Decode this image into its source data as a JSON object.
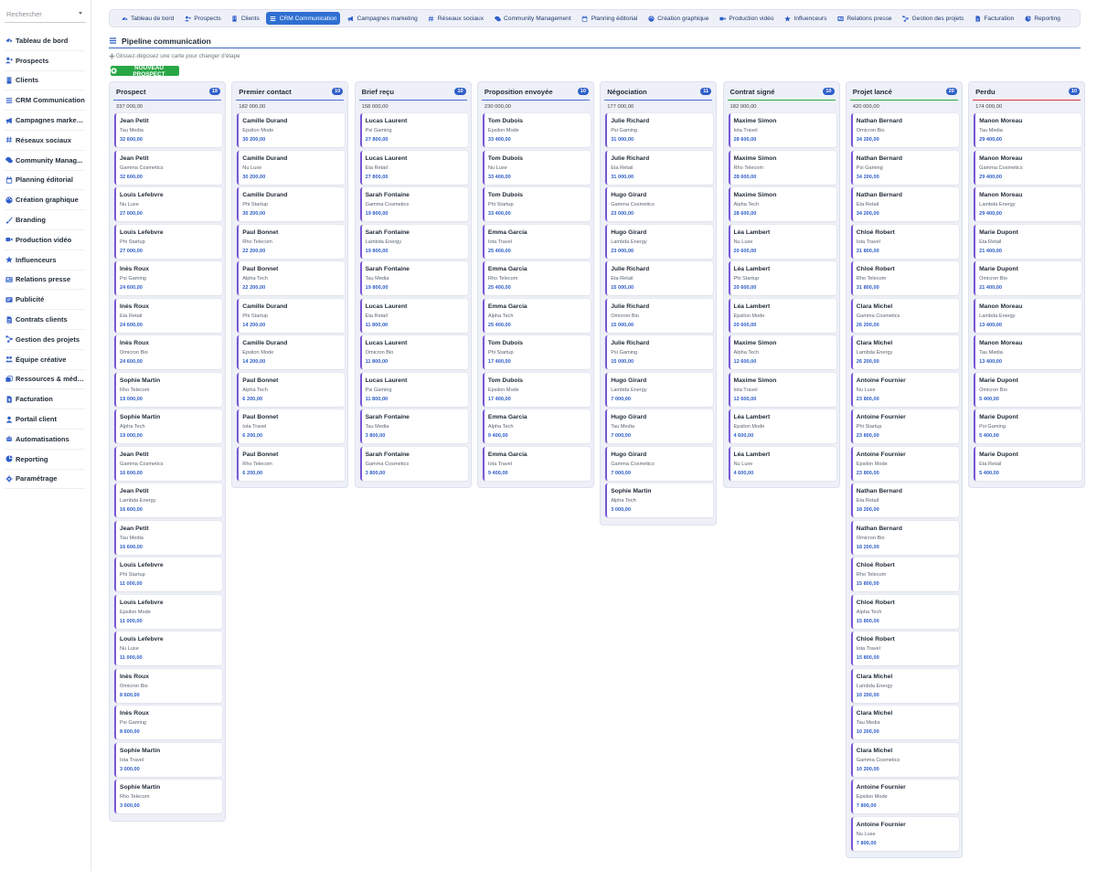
{
  "search": {
    "placeholder": "Rechercher"
  },
  "sidebar": {
    "items": [
      {
        "label": "Tableau de bord",
        "icon": "gauge-icon",
        "name": "tableau-de-bord"
      },
      {
        "label": "Prospects",
        "icon": "user-plus-icon",
        "name": "prospects"
      },
      {
        "label": "Clients",
        "icon": "building-icon",
        "name": "clients"
      },
      {
        "label": "CRM Communication",
        "icon": "bars-icon",
        "name": "crm-communication"
      },
      {
        "label": "Campagnes marketing",
        "icon": "megaphone-icon",
        "name": "campagnes-marketing"
      },
      {
        "label": "Réseaux sociaux",
        "icon": "hashtag-icon",
        "name": "reseaux-sociaux"
      },
      {
        "label": "Community Manag...",
        "icon": "comments-icon",
        "name": "community-management"
      },
      {
        "label": "Planning éditorial",
        "icon": "calendar-icon",
        "name": "planning-editorial"
      },
      {
        "label": "Création graphique",
        "icon": "palette-icon",
        "name": "creation-graphique"
      },
      {
        "label": "Branding",
        "icon": "brush-icon",
        "name": "branding"
      },
      {
        "label": "Production vidéo",
        "icon": "video-icon",
        "name": "production-video"
      },
      {
        "label": "Influenceurs",
        "icon": "star-icon",
        "name": "influenceurs"
      },
      {
        "label": "Relations presse",
        "icon": "newspaper-icon",
        "name": "relations-presse"
      },
      {
        "label": "Publicité",
        "icon": "ad-icon",
        "name": "publicite"
      },
      {
        "label": "Contrats clients",
        "icon": "contract-icon",
        "name": "contrats-clients"
      },
      {
        "label": "Gestion des projets",
        "icon": "project-diagram-icon",
        "name": "gestion-des-projets"
      },
      {
        "label": "Équipe créative",
        "icon": "users-icon",
        "name": "equipe-creative"
      },
      {
        "label": "Ressources & médias",
        "icon": "photo-video-icon",
        "name": "ressources-medias"
      },
      {
        "label": "Facturation",
        "icon": "invoice-icon",
        "name": "facturation"
      },
      {
        "label": "Portail client",
        "icon": "portal-icon",
        "name": "portail-client"
      },
      {
        "label": "Automatisations",
        "icon": "robot-icon",
        "name": "automatisations"
      },
      {
        "label": "Reporting",
        "icon": "chart-pie-icon",
        "name": "reporting"
      },
      {
        "label": "Paramétrage",
        "icon": "gear-icon",
        "name": "parametrage"
      }
    ]
  },
  "tabs": [
    {
      "label": "Tableau de bord",
      "icon": "gauge-icon",
      "name": "tableau-de-bord"
    },
    {
      "label": "Prospects",
      "icon": "user-plus-icon",
      "name": "prospects"
    },
    {
      "label": "Clients",
      "icon": "building-icon",
      "name": "clients"
    },
    {
      "label": "CRM Communication",
      "icon": "bars-icon",
      "name": "crm-communication",
      "active": true
    },
    {
      "label": "Campagnes marketing",
      "icon": "megaphone-icon",
      "name": "campagnes-marketing"
    },
    {
      "label": "Réseaux sociaux",
      "icon": "hashtag-icon",
      "name": "reseaux-sociaux"
    },
    {
      "label": "Community Management",
      "icon": "comments-icon",
      "name": "community-management"
    },
    {
      "label": "Planning éditorial",
      "icon": "calendar-icon",
      "name": "planning-editorial"
    },
    {
      "label": "Création graphique",
      "icon": "palette-icon",
      "name": "creation-graphique"
    },
    {
      "label": "Production vidéo",
      "icon": "video-icon",
      "name": "production-video"
    },
    {
      "label": "Influenceurs",
      "icon": "star-icon",
      "name": "influenceurs"
    },
    {
      "label": "Relations presse",
      "icon": "newspaper-icon",
      "name": "relations-presse"
    },
    {
      "label": "Gestion des projets",
      "icon": "project-diagram-icon",
      "name": "gestion-des-projets"
    },
    {
      "label": "Facturation",
      "icon": "invoice-icon",
      "name": "facturation"
    },
    {
      "label": "Reporting",
      "icon": "chart-pie-icon",
      "name": "reporting"
    }
  ],
  "page": {
    "title": "Pipeline communication",
    "hint": "Glissez-déposez une carte pour changer d'étape",
    "new_button": "NOUVEAU PROSPECT"
  },
  "colors": {
    "accent": "#2f6fd1",
    "card_border": "#7957d5",
    "amount": "#2f5fc9",
    "success": "#28a745",
    "danger": "#dc3545"
  },
  "columns": [
    {
      "title": "Prospect",
      "count": "19",
      "total": "337 000,00",
      "accent": "#4a6fcf",
      "cards": [
        {
          "name": "Jean Petit",
          "company": "Tau Media",
          "amount": "32 600,00"
        },
        {
          "name": "Jean Petit",
          "company": "Gamma Cosmetics",
          "amount": "32 600,00"
        },
        {
          "name": "Louis Lefebvre",
          "company": "Nu Luxe",
          "amount": "27 000,00"
        },
        {
          "name": "Louis Lefebvre",
          "company": "Phi Startup",
          "amount": "27 000,00"
        },
        {
          "name": "Inès Roux",
          "company": "Psi Gaming",
          "amount": "24 600,00"
        },
        {
          "name": "Inès Roux",
          "company": "Eta Retail",
          "amount": "24 600,00"
        },
        {
          "name": "Inès Roux",
          "company": "Omicron Bio",
          "amount": "24 600,00"
        },
        {
          "name": "Sophie Martin",
          "company": "Rho Telecom",
          "amount": "19 000,00"
        },
        {
          "name": "Sophie Martin",
          "company": "Alpha Tech",
          "amount": "19 000,00"
        },
        {
          "name": "Jean Petit",
          "company": "Gamma Cosmetics",
          "amount": "16 600,00"
        },
        {
          "name": "Jean Petit",
          "company": "Lambda Energy",
          "amount": "16 600,00"
        },
        {
          "name": "Jean Petit",
          "company": "Tau Media",
          "amount": "16 600,00"
        },
        {
          "name": "Louis Lefebvre",
          "company": "Phi Startup",
          "amount": "11 000,00"
        },
        {
          "name": "Louis Lefebvre",
          "company": "Epsilon Mode",
          "amount": "11 000,00"
        },
        {
          "name": "Louis Lefebvre",
          "company": "Nu Luxe",
          "amount": "11 000,00"
        },
        {
          "name": "Inès Roux",
          "company": "Omicron Bio",
          "amount": "8 600,00"
        },
        {
          "name": "Inès Roux",
          "company": "Psi Gaming",
          "amount": "8 600,00"
        },
        {
          "name": "Sophie Martin",
          "company": "Iota Travel",
          "amount": "3 000,00"
        },
        {
          "name": "Sophie Martin",
          "company": "Rho Telecom",
          "amount": "3 000,00"
        }
      ]
    },
    {
      "title": "Premier contact",
      "count": "10",
      "total": "182 000,00",
      "accent": "#4a6fcf",
      "cards": [
        {
          "name": "Camille Durand",
          "company": "Epsilon Mode",
          "amount": "30 200,00"
        },
        {
          "name": "Camille Durand",
          "company": "Nu Luxe",
          "amount": "30 200,00"
        },
        {
          "name": "Camille Durand",
          "company": "Phi Startup",
          "amount": "30 200,00"
        },
        {
          "name": "Paul Bonnet",
          "company": "Rho Telecom",
          "amount": "22 200,00"
        },
        {
          "name": "Paul Bonnet",
          "company": "Alpha Tech",
          "amount": "22 200,00"
        },
        {
          "name": "Camille Durand",
          "company": "Phi Startup",
          "amount": "14 200,00"
        },
        {
          "name": "Camille Durand",
          "company": "Epsilon Mode",
          "amount": "14 200,00"
        },
        {
          "name": "Paul Bonnet",
          "company": "Alpha Tech",
          "amount": "6 200,00"
        },
        {
          "name": "Paul Bonnet",
          "company": "Iota Travel",
          "amount": "6 200,00"
        },
        {
          "name": "Paul Bonnet",
          "company": "Rho Telecom",
          "amount": "6 200,00"
        }
      ]
    },
    {
      "title": "Brief reçu",
      "count": "10",
      "total": "158 000,00",
      "accent": "#4a6fcf",
      "cards": [
        {
          "name": "Lucas Laurent",
          "company": "Psi Gaming",
          "amount": "27 800,00"
        },
        {
          "name": "Lucas Laurent",
          "company": "Eta Retail",
          "amount": "27 800,00"
        },
        {
          "name": "Sarah Fontaine",
          "company": "Gamma Cosmetics",
          "amount": "19 800,00"
        },
        {
          "name": "Sarah Fontaine",
          "company": "Lambda Energy",
          "amount": "19 800,00"
        },
        {
          "name": "Sarah Fontaine",
          "company": "Tau Media",
          "amount": "19 800,00"
        },
        {
          "name": "Lucas Laurent",
          "company": "Eta Retail",
          "amount": "11 800,00"
        },
        {
          "name": "Lucas Laurent",
          "company": "Omicron Bio",
          "amount": "11 800,00"
        },
        {
          "name": "Lucas Laurent",
          "company": "Psi Gaming",
          "amount": "11 800,00"
        },
        {
          "name": "Sarah Fontaine",
          "company": "Tau Media",
          "amount": "3 800,00"
        },
        {
          "name": "Sarah Fontaine",
          "company": "Gamma Cosmetics",
          "amount": "3 800,00"
        }
      ]
    },
    {
      "title": "Proposition envoyée",
      "count": "10",
      "total": "230 000,00",
      "accent": "#4a6fcf",
      "cards": [
        {
          "name": "Tom Dubois",
          "company": "Epsilon Mode",
          "amount": "33 400,00"
        },
        {
          "name": "Tom Dubois",
          "company": "Nu Luxe",
          "amount": "33 400,00"
        },
        {
          "name": "Tom Dubois",
          "company": "Phi Startup",
          "amount": "33 400,00"
        },
        {
          "name": "Emma Garcia",
          "company": "Iota Travel",
          "amount": "25 400,00"
        },
        {
          "name": "Emma Garcia",
          "company": "Rho Telecom",
          "amount": "25 400,00"
        },
        {
          "name": "Emma Garcia",
          "company": "Alpha Tech",
          "amount": "25 400,00"
        },
        {
          "name": "Tom Dubois",
          "company": "Phi Startup",
          "amount": "17 400,00"
        },
        {
          "name": "Tom Dubois",
          "company": "Epsilon Mode",
          "amount": "17 400,00"
        },
        {
          "name": "Emma Garcia",
          "company": "Alpha Tech",
          "amount": "9 400,00"
        },
        {
          "name": "Emma Garcia",
          "company": "Iota Travel",
          "amount": "9 400,00"
        }
      ]
    },
    {
      "title": "Négociation",
      "count": "11",
      "total": "177 000,00",
      "accent": "#4a6fcf",
      "cards": [
        {
          "name": "Julie Richard",
          "company": "Psi Gaming",
          "amount": "31 000,00"
        },
        {
          "name": "Julie Richard",
          "company": "Eta Retail",
          "amount": "31 000,00"
        },
        {
          "name": "Hugo Girard",
          "company": "Gamma Cosmetics",
          "amount": "23 000,00"
        },
        {
          "name": "Hugo Girard",
          "company": "Lambda Energy",
          "amount": "23 000,00"
        },
        {
          "name": "Julie Richard",
          "company": "Eta Retail",
          "amount": "15 000,00"
        },
        {
          "name": "Julie Richard",
          "company": "Omicron Bio",
          "amount": "15 000,00"
        },
        {
          "name": "Julie Richard",
          "company": "Psi Gaming",
          "amount": "15 000,00"
        },
        {
          "name": "Hugo Girard",
          "company": "Lambda Energy",
          "amount": "7 000,00"
        },
        {
          "name": "Hugo Girard",
          "company": "Tau Media",
          "amount": "7 000,00"
        },
        {
          "name": "Hugo Girard",
          "company": "Gamma Cosmetics",
          "amount": "7 000,00"
        },
        {
          "name": "Sophie Martin",
          "company": "Alpha Tech",
          "amount": "3 000,00"
        }
      ]
    },
    {
      "title": "Contrat signé",
      "count": "10",
      "total": "182 000,00",
      "accent": "#28a745",
      "cards": [
        {
          "name": "Maxime Simon",
          "company": "Iota Travel",
          "amount": "28 600,00"
        },
        {
          "name": "Maxime Simon",
          "company": "Rho Telecom",
          "amount": "28 600,00"
        },
        {
          "name": "Maxime Simon",
          "company": "Alpha Tech",
          "amount": "28 600,00"
        },
        {
          "name": "Léa Lambert",
          "company": "Nu Luxe",
          "amount": "20 600,00"
        },
        {
          "name": "Léa Lambert",
          "company": "Phi Startup",
          "amount": "20 600,00"
        },
        {
          "name": "Léa Lambert",
          "company": "Epsilon Mode",
          "amount": "20 600,00"
        },
        {
          "name": "Maxime Simon",
          "company": "Alpha Tech",
          "amount": "12 600,00"
        },
        {
          "name": "Maxime Simon",
          "company": "Iota Travel",
          "amount": "12 600,00"
        },
        {
          "name": "Léa Lambert",
          "company": "Epsilon Mode",
          "amount": "4 600,00"
        },
        {
          "name": "Léa Lambert",
          "company": "Nu Luxe",
          "amount": "4 600,00"
        }
      ]
    },
    {
      "title": "Projet lancé",
      "count": "20",
      "total": "420 000,00",
      "accent": "#28a745",
      "cards": [
        {
          "name": "Nathan Bernard",
          "company": "Omicron Bio",
          "amount": "34 200,00"
        },
        {
          "name": "Nathan Bernard",
          "company": "Psi Gaming",
          "amount": "34 200,00"
        },
        {
          "name": "Nathan Bernard",
          "company": "Eta Retail",
          "amount": "34 200,00"
        },
        {
          "name": "Chloé Robert",
          "company": "Iota Travel",
          "amount": "31 800,00"
        },
        {
          "name": "Chloé Robert",
          "company": "Rho Telecom",
          "amount": "31 800,00"
        },
        {
          "name": "Clara Michel",
          "company": "Gamma Cosmetics",
          "amount": "26 200,00"
        },
        {
          "name": "Clara Michel",
          "company": "Lambda Energy",
          "amount": "26 200,00"
        },
        {
          "name": "Antoine Fournier",
          "company": "Nu Luxe",
          "amount": "23 800,00"
        },
        {
          "name": "Antoine Fournier",
          "company": "Phi Startup",
          "amount": "23 800,00"
        },
        {
          "name": "Antoine Fournier",
          "company": "Epsilon Mode",
          "amount": "23 800,00"
        },
        {
          "name": "Nathan Bernard",
          "company": "Eta Retail",
          "amount": "18 200,00"
        },
        {
          "name": "Nathan Bernard",
          "company": "Omicron Bio",
          "amount": "18 200,00"
        },
        {
          "name": "Chloé Robert",
          "company": "Rho Telecom",
          "amount": "15 800,00"
        },
        {
          "name": "Chloé Robert",
          "company": "Alpha Tech",
          "amount": "15 800,00"
        },
        {
          "name": "Chloé Robert",
          "company": "Iota Travel",
          "amount": "15 800,00"
        },
        {
          "name": "Clara Michel",
          "company": "Lambda Energy",
          "amount": "10 200,00"
        },
        {
          "name": "Clara Michel",
          "company": "Tau Media",
          "amount": "10 200,00"
        },
        {
          "name": "Clara Michel",
          "company": "Gamma Cosmetics",
          "amount": "10 200,00"
        },
        {
          "name": "Antoine Fournier",
          "company": "Epsilon Mode",
          "amount": "7 800,00"
        },
        {
          "name": "Antoine Fournier",
          "company": "Nu Luxe",
          "amount": "7 800,00"
        }
      ]
    },
    {
      "title": "Perdu",
      "count": "10",
      "total": "174 000,00",
      "accent": "#dc3545",
      "cards": [
        {
          "name": "Manon Moreau",
          "company": "Tau Media",
          "amount": "29 400,00"
        },
        {
          "name": "Manon Moreau",
          "company": "Gamma Cosmetics",
          "amount": "29 400,00"
        },
        {
          "name": "Manon Moreau",
          "company": "Lambda Energy",
          "amount": "29 400,00"
        },
        {
          "name": "Marie Dupont",
          "company": "Eta Retail",
          "amount": "21 400,00"
        },
        {
          "name": "Marie Dupont",
          "company": "Omicron Bio",
          "amount": "21 400,00"
        },
        {
          "name": "Manon Moreau",
          "company": "Lambda Energy",
          "amount": "13 400,00"
        },
        {
          "name": "Manon Moreau",
          "company": "Tau Media",
          "amount": "13 400,00"
        },
        {
          "name": "Marie Dupont",
          "company": "Omicron Bio",
          "amount": "5 400,00"
        },
        {
          "name": "Marie Dupont",
          "company": "Psi Gaming",
          "amount": "5 400,00"
        },
        {
          "name": "Marie Dupont",
          "company": "Eta Retail",
          "amount": "5 400,00"
        }
      ]
    }
  ]
}
